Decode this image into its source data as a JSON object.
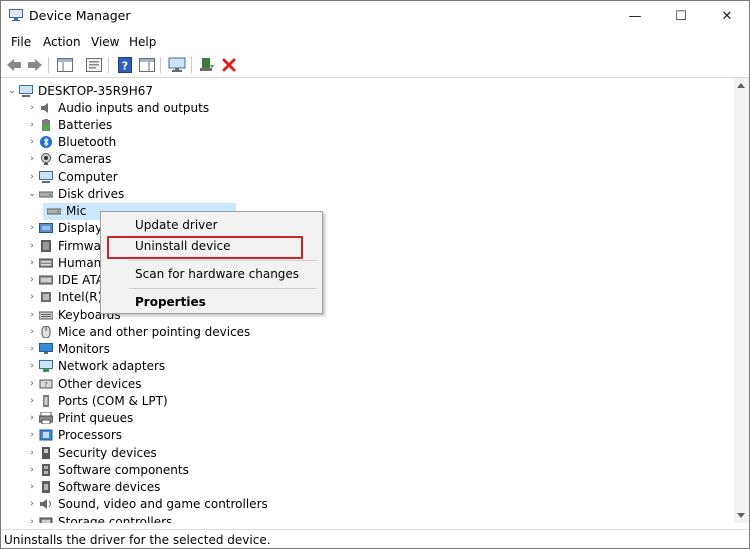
{
  "window": {
    "title": "Device Manager",
    "controls": [
      "—",
      "☐",
      "✕"
    ]
  },
  "menubar": [
    "File",
    "Action",
    "View",
    "Help"
  ],
  "toolbar": {
    "buttons": [
      "back-arrow-icon",
      "forward-arrow-icon",
      "show-hide-console-tree-icon",
      "properties-icon",
      "help-icon",
      "action-pane-icon",
      "monitor-icon",
      "update-driver-icon",
      "uninstall-x-icon"
    ],
    "uninstall_color": "#e0201b"
  },
  "tree": {
    "root": "DESKTOP-35R9H67",
    "items": [
      {
        "label": "Audio inputs and outputs",
        "icon": "speaker-icon",
        "expanded": false
      },
      {
        "label": "Batteries",
        "icon": "battery-icon",
        "expanded": false
      },
      {
        "label": "Bluetooth",
        "icon": "bluetooth-icon",
        "expanded": false
      },
      {
        "label": "Cameras",
        "icon": "camera-icon",
        "expanded": false
      },
      {
        "label": "Computer",
        "icon": "computer-icon",
        "expanded": false
      },
      {
        "label": "Disk drives",
        "icon": "disk-drive-icon",
        "expanded": true
      },
      {
        "label": "Mic",
        "icon": "disk-drive-icon",
        "child": true
      },
      {
        "label": "Display",
        "icon": "display-adapter-icon",
        "expanded": false
      },
      {
        "label": "Firmwa",
        "icon": "firmware-icon",
        "expanded": false
      },
      {
        "label": "Human",
        "icon": "keyboard-hid-icon",
        "expanded": false
      },
      {
        "label": "IDE ATA",
        "icon": "ide-controller-icon",
        "expanded": false
      },
      {
        "label": "Intel(R)",
        "icon": "chip-icon",
        "expanded": false
      },
      {
        "label": "Keyboards",
        "icon": "keyboard-icon",
        "expanded": false
      },
      {
        "label": "Mice and other pointing devices",
        "icon": "mouse-icon",
        "expanded": false
      },
      {
        "label": "Monitors",
        "icon": "monitor-icon",
        "expanded": false
      },
      {
        "label": "Network adapters",
        "icon": "network-icon",
        "expanded": false
      },
      {
        "label": "Other devices",
        "icon": "other-devices-icon",
        "expanded": false
      },
      {
        "label": "Ports (COM & LPT)",
        "icon": "port-icon",
        "expanded": false
      },
      {
        "label": "Print queues",
        "icon": "printer-icon",
        "expanded": false
      },
      {
        "label": "Processors",
        "icon": "processor-icon",
        "expanded": false
      },
      {
        "label": "Security devices",
        "icon": "security-icon",
        "expanded": false
      },
      {
        "label": "Software components",
        "icon": "software-component-icon",
        "expanded": false
      },
      {
        "label": "Software devices",
        "icon": "software-device-icon",
        "expanded": false
      },
      {
        "label": "Sound, video and game controllers",
        "icon": "sound-icon",
        "expanded": false
      },
      {
        "label": "Storage controllers",
        "icon": "storage-icon",
        "expanded": false
      }
    ]
  },
  "context_menu": {
    "items": [
      "Update driver",
      "Uninstall device",
      "Scan for hardware changes",
      "Properties"
    ],
    "highlighted": "Uninstall device",
    "highlight_color": "#c8262e"
  },
  "status": "Uninstalls the driver for the selected device."
}
